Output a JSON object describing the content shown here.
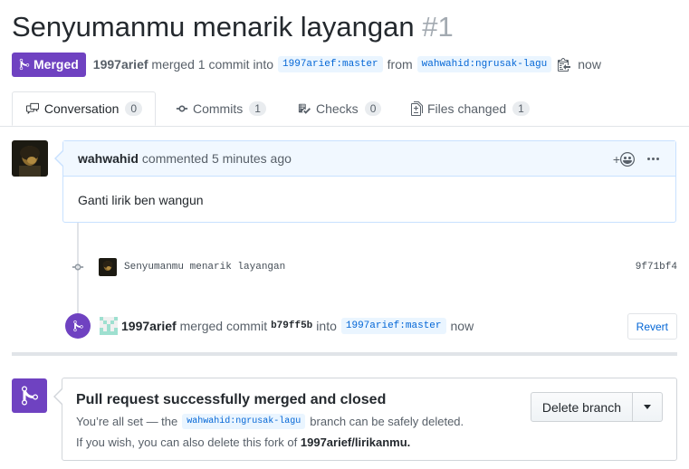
{
  "pr": {
    "title": "Senyumanmu menarik layangan",
    "number": "#1",
    "status": "Merged",
    "author": "1997arief",
    "merged_text": "merged 1 commit into",
    "base_ref": "1997arief:master",
    "from_text": "from",
    "head_ref": "wahwahid:ngrusak-lagu",
    "time": "now"
  },
  "tabs": [
    {
      "label": "Conversation",
      "count": "0",
      "icon": "comment-discussion-icon"
    },
    {
      "label": "Commits",
      "count": "1",
      "icon": "git-commit-icon"
    },
    {
      "label": "Checks",
      "count": "0",
      "icon": "checklist-icon"
    },
    {
      "label": "Files changed",
      "count": "1",
      "icon": "file-diff-icon"
    }
  ],
  "comment": {
    "author": "wahwahid",
    "action": "commented 5 minutes ago",
    "body": "Ganti lirik ben wangun",
    "reaction_icon": "smiley-icon",
    "more_icon": "kebab-horizontal-icon"
  },
  "commit": {
    "message": "Senyumanmu menarik layangan",
    "sha": "9f71bf4"
  },
  "merge_event": {
    "actor": "1997arief",
    "text1": "merged commit",
    "sha": "b79ff5b",
    "text2": "into",
    "ref": "1997arief:master",
    "time": "now",
    "revert_label": "Revert"
  },
  "merged_box": {
    "title": "Pull request successfully merged and closed",
    "line1_before": "You’re all set — the",
    "branch": "wahwahid:ngrusak-lagu",
    "line1_after": "branch can be safely deleted.",
    "line2_before": "If you wish, you can also delete this fork of",
    "fork": "1997arief/lirikanmu.",
    "delete_label": "Delete branch"
  },
  "colors": {
    "merged_purple": "#6f42c1",
    "link_blue": "#0366d6",
    "ref_bg": "#eaf5ff"
  }
}
